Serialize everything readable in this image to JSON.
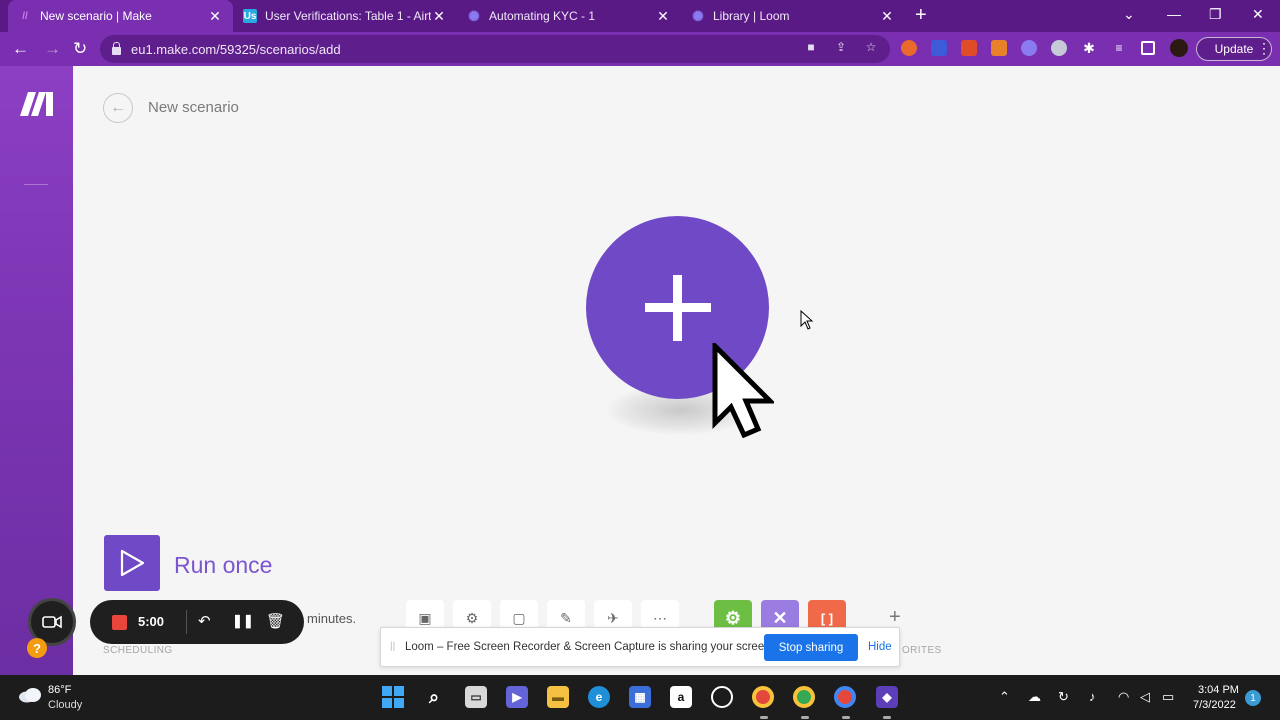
{
  "browser": {
    "tabs": [
      {
        "title": "New scenario | Make",
        "favicon": "make-logo-icon",
        "active": true
      },
      {
        "title": "User Verifications: Table 1 - Airtable",
        "favicon": "airtable-icon",
        "active": false
      },
      {
        "title": "Automating KYC - 1",
        "favicon": "loom-icon",
        "active": false
      },
      {
        "title": "Library | Loom",
        "favicon": "loom-icon",
        "active": false
      }
    ],
    "url": "eu1.make.com/59325/scenarios/add",
    "update_label": "Update"
  },
  "scenario": {
    "title": "New scenario"
  },
  "controls": {
    "run_once_label": "Run once",
    "schedule_text": "minutes.",
    "scheduling_label": "SCHEDULING",
    "favorites_label": "ORITES"
  },
  "loom": {
    "timer": "5:00",
    "share_message": "Loom – Free Screen Recorder & Screen Capture is sharing your screen.",
    "stop_sharing_label": "Stop sharing",
    "hide_label": "Hide"
  },
  "taskbar": {
    "weather_temp": "86°F",
    "weather_status": "Cloudy",
    "time": "3:04 PM",
    "date": "7/3/2022",
    "notification_count": "1"
  },
  "colors": {
    "brand_purple": "#6f49c6",
    "sidebar_gradient_top": "#8c3fc3",
    "chrome_purple": "#7a2fb0",
    "loom_blue": "#1a73e8"
  }
}
